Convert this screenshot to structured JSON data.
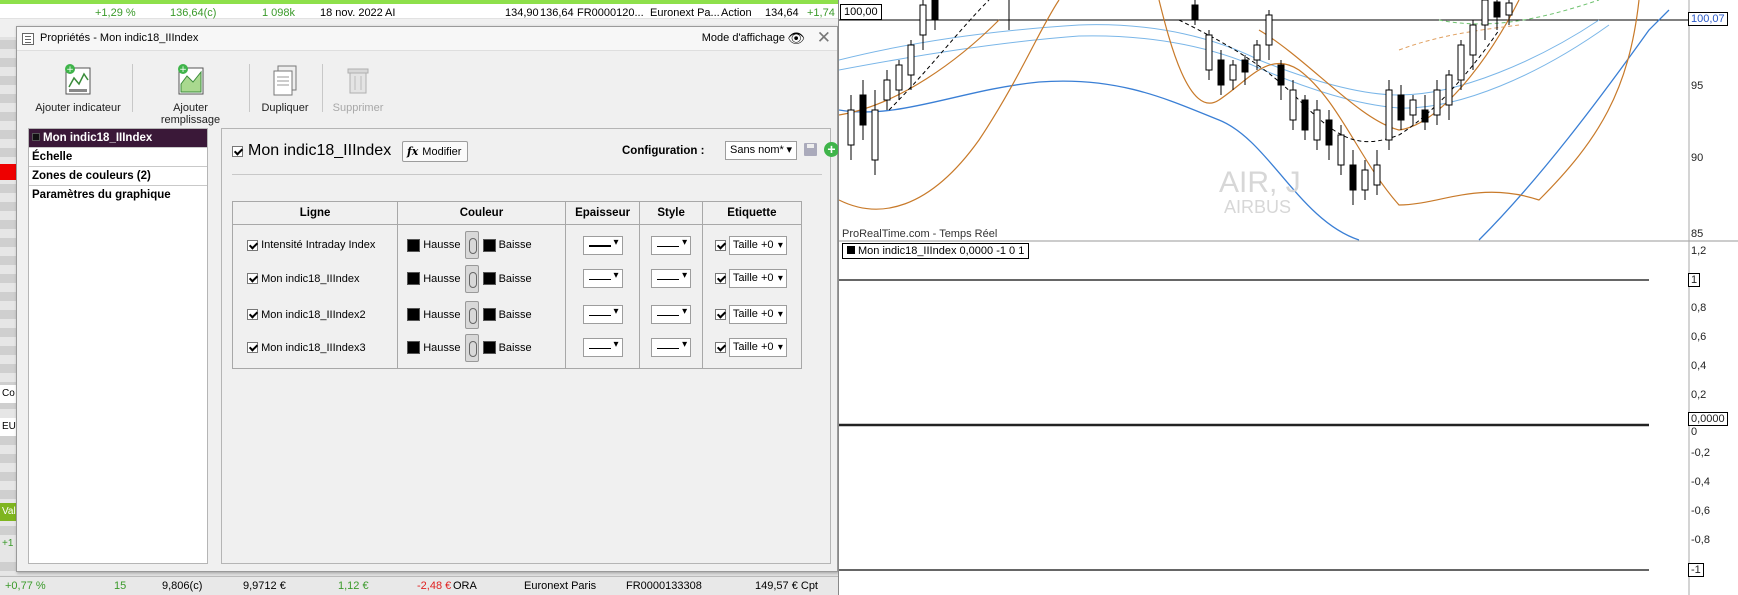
{
  "bg_table": {
    "top_row": {
      "pct": "+1,29 %",
      "price": "136,64(c)",
      "volume": "1 098k",
      "date": "18 nov. 2022",
      "ticker": "AI",
      "low": "134,90",
      "high": "136,64",
      "isin": "FR0000120...",
      "market": "Euronext Pa...",
      "type": "Action",
      "last": "134,64",
      "chg": "+1,74"
    },
    "bottom_row": {
      "pct": "+0,77 %",
      "volume": "15",
      "price": "9,806(c)",
      "avg": "9,9712 €",
      "gain": "1,12 €",
      "chg": "-2,48 €",
      "ticker": "ORA",
      "market": "Euronext Paris",
      "isin": "FR0000133308",
      "cap": "149,57 € Cpt"
    },
    "left_cells": [
      "Co",
      "EUR",
      "Val",
      "+1"
    ]
  },
  "dialog": {
    "title": "Propriétés - Mon indic18_IIIndex",
    "mode_label": "Mode d'affichage",
    "close": "✕",
    "toolbar": {
      "add_indicator": "Ajouter indicateur",
      "add_fill": "Ajouter remplissage",
      "duplicate": "Dupliquer",
      "delete": "Supprimer"
    },
    "sidebar": {
      "items": [
        "Mon indic18_IIIndex",
        "Échelle",
        "Zones de couleurs (2)",
        "Paramètres du graphique"
      ]
    },
    "panel": {
      "indicator_name": "Mon indic18_IIIndex",
      "modify_label": "Modifier",
      "modify_glyph": "fx",
      "config_label": "Configuration :",
      "config_value": "Sans nom*",
      "columns": [
        "Ligne",
        "Couleur",
        "Epaisseur",
        "Style",
        "Etiquette"
      ],
      "rows": [
        {
          "line": "Intensité Intraday Index",
          "up": "Hausse",
          "down": "Baisse",
          "label": "Taille +0",
          "thick": true
        },
        {
          "line": "Mon indic18_IIIndex",
          "up": "Hausse",
          "down": "Baisse",
          "label": "Taille +0",
          "thick": false
        },
        {
          "line": "Mon indic18_IIIndex2",
          "up": "Hausse",
          "down": "Baisse",
          "label": "Taille +0",
          "thick": false
        },
        {
          "line": "Mon indic18_IIIndex3",
          "up": "Hausse",
          "down": "Baisse",
          "label": "Taille +0",
          "thick": false
        }
      ]
    }
  },
  "chart": {
    "price_box": "100,00",
    "watermark_ticker": "AIR, J",
    "watermark_name": "AIRBUS",
    "source": "ProRealTime.com - Temps Réel",
    "indicator_legend": "Mon indic18_IIIndex 0,0000  -1  0  1",
    "price_axis": {
      "current": "100,07",
      "ticks": [
        "95",
        "90",
        "85"
      ]
    },
    "indicator_axis": {
      "ticks": [
        "1,2",
        "1",
        "0,8",
        "0,6",
        "0,4",
        "0,2",
        "0,0000",
        "0",
        "-0,2",
        "-0,4",
        "-0,6",
        "-0,8",
        "-1"
      ]
    },
    "colors": {
      "band_blue": "#3a7fd5",
      "band_light_blue": "#7ab6e8",
      "band_orange": "#c87a2a",
      "dashed_green": "#6fc26f"
    }
  }
}
